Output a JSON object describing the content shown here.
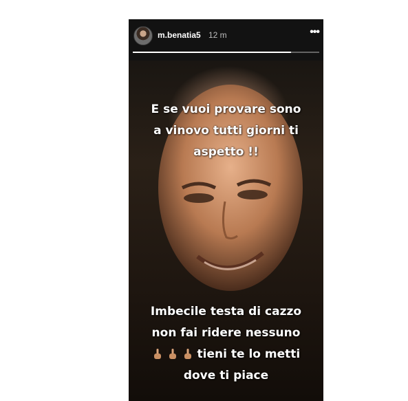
{
  "story": {
    "username": "m.benatia5",
    "time": "12 m",
    "more_label": "•••",
    "progress_fraction": 0.85,
    "caption_top": [
      "E se vuoi provare sono",
      "a vinovo tutti giorni ti",
      "aspetto !!"
    ],
    "caption_bottom": [
      "Imbecile testa di cazzo",
      "non fai ridere nessuno",
      "tieni te lo metti",
      "dove ti piace"
    ],
    "emoji_name": "middle-finger-emoji",
    "emoji_count": 3
  },
  "colors": {
    "background": "#ffffff",
    "story_bg": "#141414",
    "text": "#ffffff",
    "meta_text": "#bdbdbd"
  }
}
